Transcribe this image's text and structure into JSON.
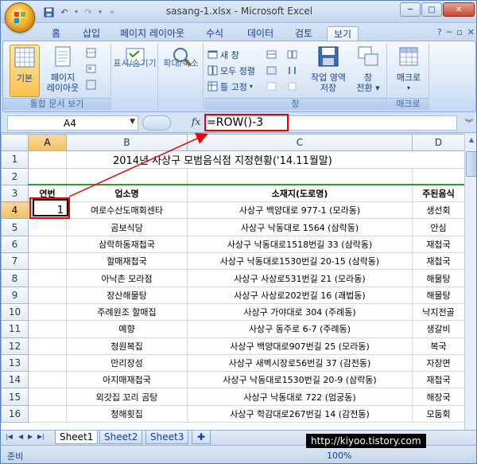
{
  "window": {
    "title": "sasang-1.xlsx - Microsoft Excel",
    "controls": {
      "minimize": "─",
      "maximize": "□",
      "close": "✕"
    }
  },
  "tabs": [
    "홈",
    "삽입",
    "페이지 레이아웃",
    "수식",
    "데이터",
    "검토",
    "보기"
  ],
  "active_tab": "보기",
  "ribbon": {
    "groups": {
      "workbook_views": {
        "label": "통합 문서 보기",
        "normal": "기본",
        "page_layout_1": "페이지",
        "page_layout_2": "레이아웃"
      },
      "show": {
        "label": "표시/숨기기"
      },
      "zoom": {
        "label": "확대/축소"
      },
      "window": {
        "label": "창",
        "new_window": "새 창",
        "arrange_all": "모두 정렬",
        "freeze_panes": "틀 고정",
        "save_workspace_1": "작업 영역",
        "save_workspace_2": "저장",
        "switch_windows_1": "창",
        "switch_windows_2": "전환"
      },
      "macros": {
        "label": "매크로",
        "button": "매크로"
      }
    }
  },
  "formula_bar": {
    "name_box": "A4",
    "fx": "fx",
    "formula": "=ROW()-3"
  },
  "grid": {
    "columns": [
      "A",
      "B",
      "C",
      "D"
    ],
    "row_numbers": [
      "1",
      "2",
      "3",
      "4",
      "5",
      "6",
      "7",
      "8",
      "9",
      "10",
      "11",
      "12",
      "13",
      "14",
      "15",
      "16"
    ],
    "title": "2014년 사상구 모범음식점 지정현황('14.11월말)",
    "headers": [
      "연번",
      "업소명",
      "소재지(도로명)",
      "주된음식"
    ],
    "rows": [
      [
        "1",
        "여로수산도매회센타",
        "사상구 백양대로 977-1 (모라동)",
        "생선회"
      ],
      [
        "",
        "곰보식당",
        "사상구 낙동대로 1564 (삼락동)",
        "안심"
      ],
      [
        "",
        "삼락하동재첩국",
        "사상구 낙동대로1518번길 33 (삼락동)",
        "재첩국"
      ],
      [
        "",
        "할매재첩국",
        "사상구 낙동대로1530번길 20-15 (삼락동)",
        "재첩국"
      ],
      [
        "",
        "아낙촌 모라점",
        "사상구 사상로531번길 21 (모라동)",
        "해물탕"
      ],
      [
        "",
        "장산해물탕",
        "사상구 사상로202번길 16 (괘법동)",
        "해물탕"
      ],
      [
        "",
        "주례원조 할매집",
        "사상구 가야대로 304 (주례동)",
        "낙지전골"
      ],
      [
        "",
        "예향",
        "사상구 동주로 6-7 (주례동)",
        "생갈비"
      ],
      [
        "",
        "청원복집",
        "사상구 백양대로907번길 25 (모라동)",
        "복국"
      ],
      [
        "",
        "만리장성",
        "사상구 새벽시장로56번길 37 (감전동)",
        "자장면"
      ],
      [
        "",
        "아지매재첩국",
        "사상구 낙동대로1530번길 20-9 (삼락동)",
        "재첩국"
      ],
      [
        "",
        "외갓집 꼬리 곰탕",
        "사상구 낙동대로 722 (엄궁동)",
        "해장국"
      ],
      [
        "",
        "청해횟집",
        "사상구 학감대로267번길 14 (감전동)",
        "모둠회"
      ]
    ]
  },
  "sheet_tabs": [
    "Sheet1",
    "Sheet2",
    "Sheet3"
  ],
  "status": {
    "text": "준비",
    "zoom": "100%"
  },
  "watermark": "http://kiyoo.tistory.com"
}
